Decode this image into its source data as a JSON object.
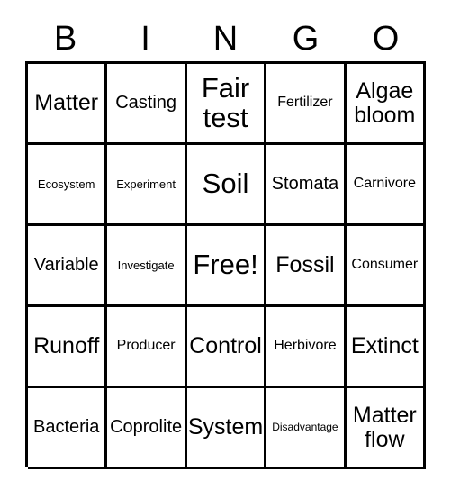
{
  "card": {
    "header_letters": [
      "B",
      "I",
      "N",
      "G",
      "O"
    ],
    "rows": [
      [
        {
          "label": "Matter",
          "size": "lg"
        },
        {
          "label": "Casting",
          "size": "md"
        },
        {
          "label": "Fair test",
          "size": "xl"
        },
        {
          "label": "Fertilizer",
          "size": "sm"
        },
        {
          "label": "Algae bloom",
          "size": "lg"
        }
      ],
      [
        {
          "label": "Ecosystem",
          "size": "xs"
        },
        {
          "label": "Experiment",
          "size": "xs"
        },
        {
          "label": "Soil",
          "size": "xl"
        },
        {
          "label": "Stomata",
          "size": "md"
        },
        {
          "label": "Carnivore",
          "size": "sm"
        }
      ],
      [
        {
          "label": "Variable",
          "size": "md"
        },
        {
          "label": "Investigate",
          "size": "xs"
        },
        {
          "label": "Free!",
          "size": "xl"
        },
        {
          "label": "Fossil",
          "size": "lg"
        },
        {
          "label": "Consumer",
          "size": "sm"
        }
      ],
      [
        {
          "label": "Runoff",
          "size": "lg"
        },
        {
          "label": "Producer",
          "size": "sm"
        },
        {
          "label": "Control",
          "size": "lg"
        },
        {
          "label": "Herbivore",
          "size": "sm"
        },
        {
          "label": "Extinct",
          "size": "lg"
        }
      ],
      [
        {
          "label": "Bacteria",
          "size": "md"
        },
        {
          "label": "Coprolite",
          "size": "md"
        },
        {
          "label": "System",
          "size": "lg"
        },
        {
          "label": "Disadvantage",
          "size": "xxs"
        },
        {
          "label": "Matter flow",
          "size": "lg"
        }
      ]
    ]
  }
}
